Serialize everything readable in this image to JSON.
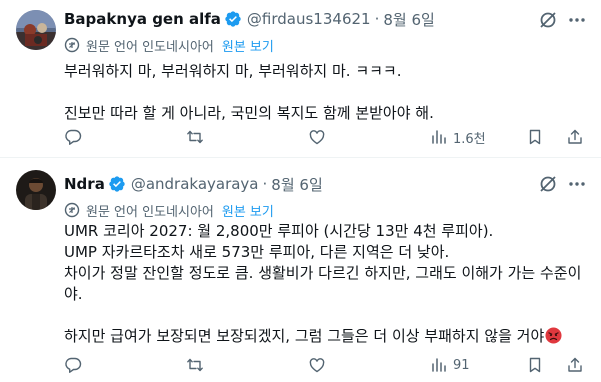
{
  "tweets": [
    {
      "display_name": "Bapaknya gen alfa",
      "handle": "@firdaus134621",
      "separator": "·",
      "date": "8월 6일",
      "translate_note": "원문 언어 인도네시아어",
      "show_original": "원본 보기",
      "text_lines": [
        "부러워하지 마, 부러워하지 마, 부러워하지 마. ㅋㅋㅋ.",
        "",
        "진보만 따라 할 게 아니라, 국민의 복지도 함께 본받아야 해."
      ],
      "views": "1.6천",
      "icons": [
        "verified-badge-icon",
        "grok-icon",
        "more-icon",
        "translate-icon",
        "reply-icon",
        "retweet-icon",
        "like-icon",
        "views-icon",
        "bookmark-icon",
        "share-icon"
      ]
    },
    {
      "display_name": "Ndra",
      "handle": "@andrakayaraya",
      "separator": "·",
      "date": "8월 6일",
      "translate_note": "원문 언어 인도네시아어",
      "show_original": "원본 보기",
      "text_lines": [
        "UMR 코리아 2027: 월 2,800만 루피아 (시간당 13만 4천 루피아).",
        "UMP 자카르타조차 새로 573만 루피아, 다른 지역은 더 낮아.",
        "차이가 정말 잔인할 정도로 큼. 생활비가 다르긴 하지만, 그래도 이해가 가는 수준이야.",
        "",
        "하지만 급여가 보장되면 보장되겠지, 그럼 그들은 더 이상 부패하지 않을 거야"
      ],
      "views": "91",
      "icons": [
        "verified-badge-icon",
        "grok-icon",
        "more-icon",
        "translate-icon",
        "angry-face-emoji",
        "reply-icon",
        "retweet-icon",
        "like-icon",
        "views-icon",
        "bookmark-icon",
        "share-icon"
      ]
    }
  ],
  "colors": {
    "text": "#0f1419",
    "secondary": "#536471",
    "link": "#1d9bf0",
    "verified": "#1d9bf0",
    "divider": "#eff3f4"
  }
}
